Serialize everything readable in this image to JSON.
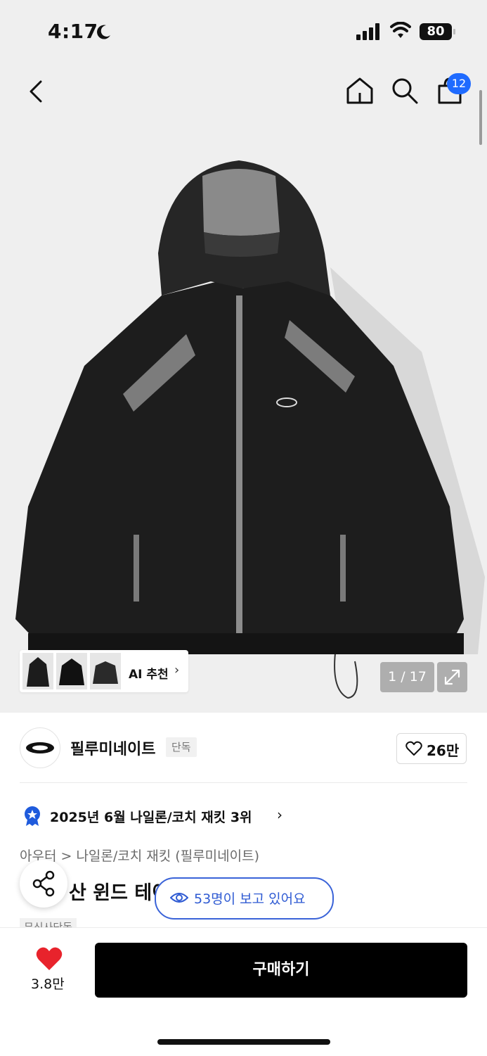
{
  "status_bar": {
    "time": "4:17",
    "battery": "80"
  },
  "header": {
    "cart_count": "12"
  },
  "gallery": {
    "ai_label": "AI 추천",
    "counter": "1 / 17"
  },
  "brand": {
    "name": "필루미네이트",
    "tag": "단독",
    "likes": "26만"
  },
  "ranking": {
    "text": "2025년 6월 나일론/코치 재킷 3위"
  },
  "product": {
    "breadcrumb": "아우터 > 나일론/코치 재킷 (필루미네이트)",
    "title_visible": "산 윈드 테이",
    "tag_partial": "무신사단독"
  },
  "viewers": {
    "text": "53명이 보고 있어요"
  },
  "bottom": {
    "wish_count": "3.8만",
    "buy_label": "구매하기"
  },
  "colors": {
    "accent": "#1f6bff",
    "pill_border": "#3a63d8",
    "heart": "#e8232c"
  }
}
